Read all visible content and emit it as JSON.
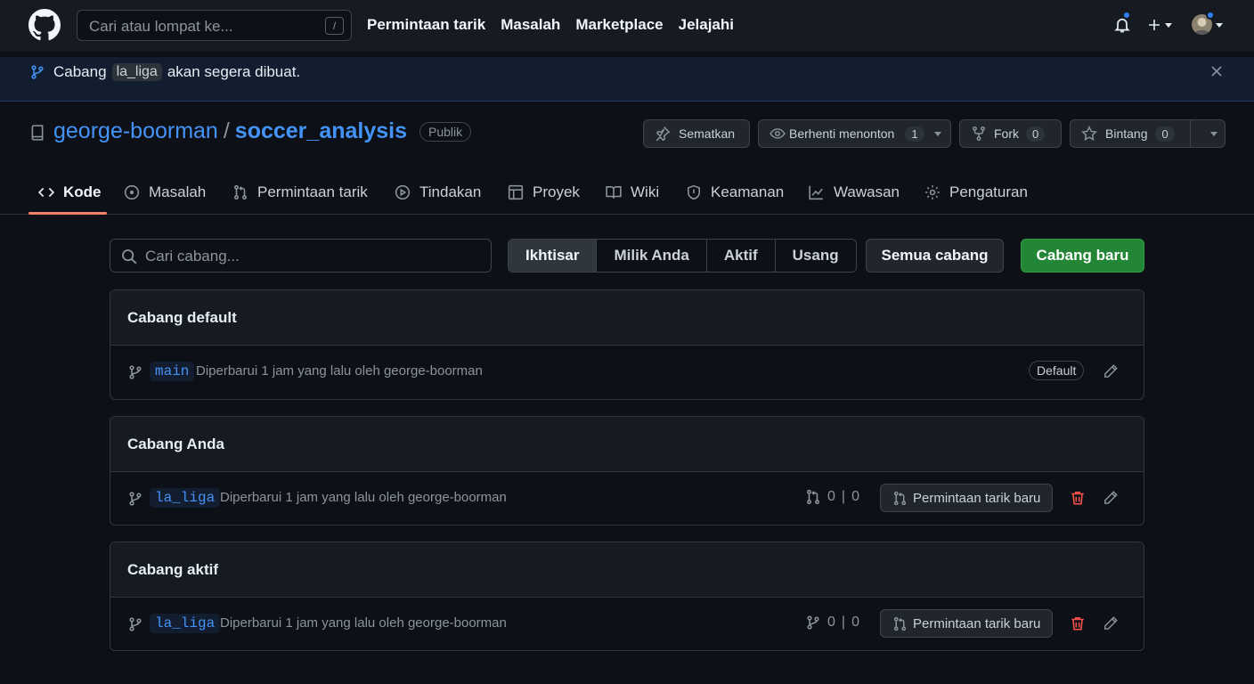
{
  "header": {
    "search_placeholder": "Cari atau lompat ke...",
    "search_shortcut": "/",
    "nav": [
      "Permintaan tarik",
      "Masalah",
      "Marketplace",
      "Jelajahi"
    ]
  },
  "flash": {
    "prefix": "Cabang",
    "branch": "la_liga",
    "suffix": "akan segera dibuat."
  },
  "repo": {
    "owner": "george-boorman",
    "separator": "/",
    "name": "soccer_analysis",
    "visibility": "Publik",
    "pin_label": "Sematkan",
    "watch_label": "Berhenti menonton",
    "watch_count": "1",
    "fork_label": "Fork",
    "fork_count": "0",
    "star_label": "Bintang",
    "star_count": "0"
  },
  "tabs": [
    "Kode",
    "Masalah",
    "Permintaan tarik",
    "Tindakan",
    "Proyek",
    "Wiki",
    "Keamanan",
    "Wawasan",
    "Pengaturan"
  ],
  "filters": {
    "search_placeholder": "Cari cabang...",
    "segments": [
      "Ikhtisar",
      "Milik Anda",
      "Aktif",
      "Usang"
    ],
    "selected": "Ikhtisar",
    "all_branches": "Semua cabang",
    "new_branch": "Cabang baru"
  },
  "sections": [
    {
      "title": "Cabang default",
      "branch": "main",
      "meta": "Diperbarui 1 jam yang lalu oleh george-boorman",
      "label": "Default"
    },
    {
      "title": "Cabang Anda",
      "branch": "la_liga",
      "meta": "Diperbarui 1 jam yang lalu oleh george-boorman",
      "behind": "0",
      "divider": "|",
      "ahead": "0",
      "new_pr": "Permintaan tarik baru"
    },
    {
      "title": "Cabang aktif",
      "branch": "la_liga",
      "meta": "Diperbarui 1 jam yang lalu oleh george-boorman",
      "behind": "0",
      "divider": "|",
      "ahead": "0",
      "new_pr": "Permintaan tarik baru"
    }
  ],
  "colors": {
    "accent": "#4493f8",
    "primary_button": "#238636",
    "danger": "#f85149",
    "tab_underline": "#f78166"
  }
}
